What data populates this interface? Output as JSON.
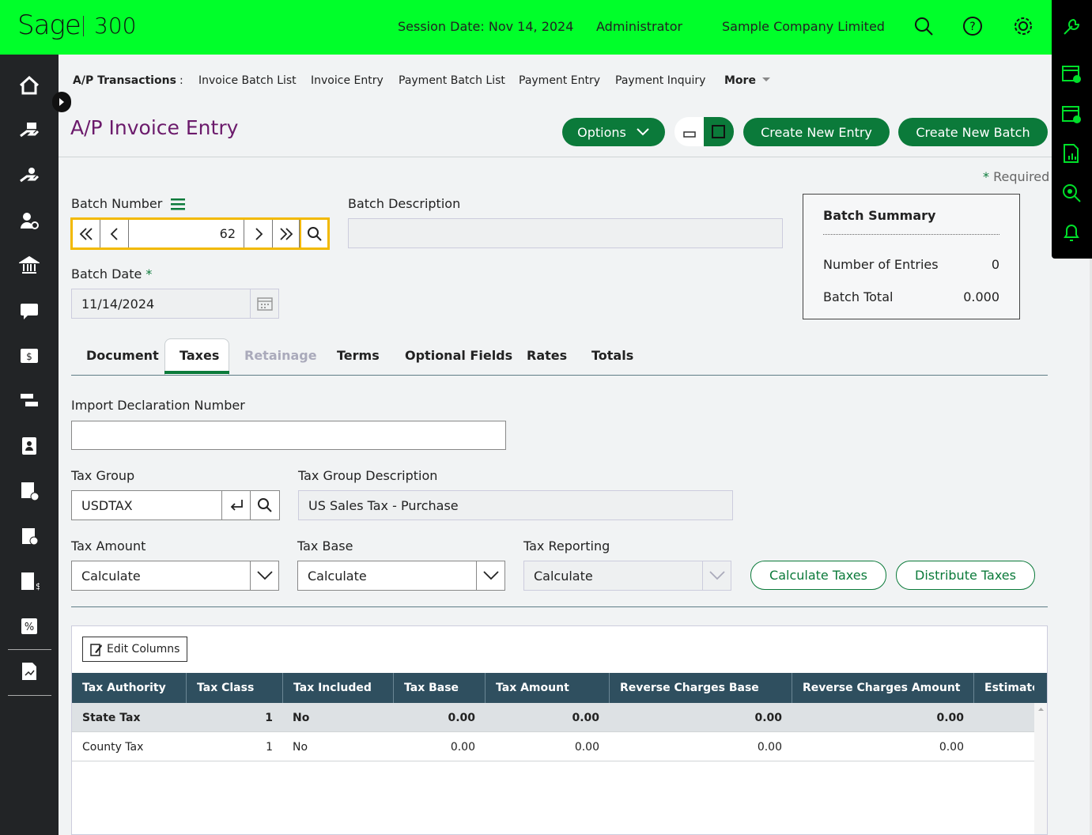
{
  "header": {
    "logo": "Sage",
    "product": "300",
    "session_date": "Session Date:  Nov 14, 2024",
    "user": "Administrator",
    "company": "Sample Company Limited"
  },
  "breadcrumb": {
    "module": "A/P Transactions",
    "separator": ":",
    "items": [
      "Invoice Batch List",
      "Invoice Entry",
      "Payment Batch List",
      "Payment Entry",
      "Payment Inquiry"
    ],
    "more": "More"
  },
  "page": {
    "title": "A/P Invoice Entry",
    "options_label": "Options",
    "create_entry_label": "Create New Entry",
    "create_batch_label": "Create New Batch",
    "required_note": "Required"
  },
  "batch": {
    "number_label": "Batch Number",
    "number_value": "62",
    "description_label": "Batch Description",
    "description_value": "",
    "date_label": "Batch Date",
    "date_value": "11/14/2024"
  },
  "summary": {
    "title": "Batch Summary",
    "entries_label": "Number of Entries",
    "entries_value": "0",
    "total_label": "Batch Total",
    "total_value": "0.000"
  },
  "tabs": [
    "Document",
    "Taxes",
    "Retainage",
    "Terms",
    "Optional Fields",
    "Rates",
    "Totals"
  ],
  "taxes": {
    "import_decl_label": "Import Declaration Number",
    "import_decl_value": "",
    "tax_group_label": "Tax Group",
    "tax_group_value": "USDTAX",
    "tax_group_desc_label": "Tax Group Description",
    "tax_group_desc_value": "US Sales Tax - Purchase",
    "tax_amount_label": "Tax Amount",
    "tax_amount_value": "Calculate",
    "tax_base_label": "Tax Base",
    "tax_base_value": "Calculate",
    "tax_reporting_label": "Tax Reporting",
    "tax_reporting_value": "Calculate",
    "calc_taxes_label": "Calculate Taxes",
    "dist_taxes_label": "Distribute Taxes"
  },
  "grid": {
    "edit_columns_label": "Edit Columns",
    "columns": [
      "Tax Authority",
      "Tax Class",
      "Tax Included",
      "Tax Base",
      "Tax Amount",
      "Reverse Charges Base",
      "Reverse Charges Amount",
      "Estimated"
    ],
    "rows": [
      [
        "State Tax",
        "1",
        "No",
        "0.00",
        "0.00",
        "0.00",
        "0.00"
      ],
      [
        "County Tax",
        "1",
        "No",
        "0.00",
        "0.00",
        "0.00",
        "0.00"
      ]
    ]
  },
  "colors": {
    "topbar": "#00ff2a",
    "accent": "#0b7a3a",
    "title": "#6b1a6b",
    "grid_header": "#2f4f5f"
  }
}
